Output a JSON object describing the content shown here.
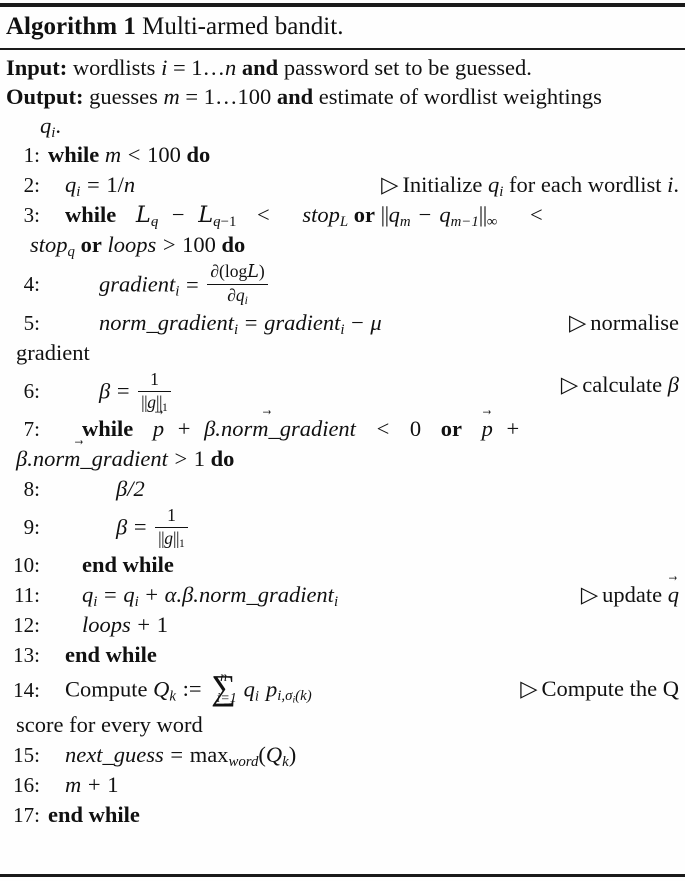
{
  "algorithm": {
    "caption_label": "Algorithm 1",
    "caption_title": "Multi-armed bandit.",
    "io": {
      "input_label": "Input:",
      "input_text_a": "wordlists",
      "input_math_i": "i",
      "input_eq": "= 1",
      "input_dots": "…",
      "input_n": "n",
      "input_and": "and",
      "input_text_b": "password set to be guessed.",
      "output_label": "Output:",
      "output_text_a": "guesses",
      "output_math_m": "m",
      "output_eq": "= 1",
      "output_dots": "…",
      "output_100": "100",
      "output_and": "and",
      "output_text_b": "estimate of wordlist weightings",
      "output_cont_q": "q",
      "output_cont_sub": "i",
      "output_cont_period": "."
    },
    "comment_marker": "▷",
    "lines": [
      {
        "number": "1:",
        "indent": 0,
        "kw_while": "while",
        "var_m": "m",
        "rel": "<",
        "val": "100",
        "kw_do": "do"
      },
      {
        "number": "2:",
        "indent": 1,
        "q": "q",
        "q_sub": "i",
        "eq": "=",
        "frac_inline": "1/",
        "n": "n",
        "comment_a": "Initialize",
        "comment_q": "q",
        "comment_q_sub": "i",
        "comment_b": "for each wordlist",
        "comment_i": "i",
        "comment_end": "."
      },
      {
        "number": "3:",
        "indent": 1,
        "kw_while": "while",
        "L1": "L",
        "L1_sub": "q",
        "minus": "−",
        "L2": "L",
        "L2_sub_q": "q",
        "L2_sub_rest": "−1",
        "rel1": "<",
        "stopL": "stop",
        "stopL_sub": "L",
        "or1": "or",
        "norm_open": "||",
        "qm": "q",
        "qm_sub": "m",
        "minus2": "−",
        "qm1": "q",
        "qm1_sub": "m−1",
        "norm_close": "||",
        "norm_sub": "∞",
        "rel2": "<",
        "cont_stopq": "stop",
        "cont_stopq_sub": "q",
        "or2": "or",
        "loops": "loops",
        "rel3": ">",
        "val": "100",
        "kw_do": "do"
      },
      {
        "number": "4:",
        "indent": 2,
        "lhs": "gradient",
        "lhs_sub": "i",
        "eq": "=",
        "frac_num_d": "∂(log",
        "frac_num_L": "L",
        "frac_num_close": ")",
        "frac_den_d": "∂q",
        "frac_den_sub": "i"
      },
      {
        "number": "5:",
        "indent": 2,
        "lhs": "norm_gradient",
        "lhs_sub": "i",
        "eq": "=",
        "rhs": "gradient",
        "rhs_sub": "i",
        "minus": "−",
        "mu": "μ",
        "comment": "normalise",
        "cont": "gradient"
      },
      {
        "number": "6:",
        "indent": 2,
        "beta": "β",
        "eq": "=",
        "frac_num": "1",
        "frac_den_open": "||",
        "frac_den_g": "g",
        "frac_den_close": "||",
        "frac_den_sub": "1",
        "comment": "calculate",
        "comment_beta": "β"
      },
      {
        "number": "7:",
        "indent": 2,
        "kw_while": "while",
        "p1": "p",
        "plus1": "+",
        "beta1": "β.",
        "ng1": "norm_gradient",
        "rel1": "<",
        "zero": "0",
        "or": "or",
        "p2": "p",
        "plus2": "+",
        "cont_beta": "β.",
        "cont_ng": "norm_gradient",
        "cont_rel": ">",
        "cont_one": "1",
        "kw_do": "do"
      },
      {
        "number": "8:",
        "indent": 3,
        "text": "β/2"
      },
      {
        "number": "9:",
        "indent": 3,
        "beta": "β",
        "eq": "=",
        "frac_num": "1",
        "frac_den_open": "||",
        "frac_den_g": "g",
        "frac_den_close": "||",
        "frac_den_sub": "1"
      },
      {
        "number": "10:",
        "indent": 2,
        "kw": "end while"
      },
      {
        "number": "11:",
        "indent": 2,
        "q": "q",
        "q_sub": "i",
        "eq": "=",
        "q2": "q",
        "q2_sub": "i",
        "plus": "+",
        "alpha": "α.",
        "beta": "β.",
        "ng": "norm_gradient",
        "ng_sub": "i",
        "comment": "update",
        "comment_q": "q"
      },
      {
        "number": "12:",
        "indent": 2,
        "loops": "loops",
        "plus": "+",
        "one": "1"
      },
      {
        "number": "13:",
        "indent": 1,
        "kw": "end while"
      },
      {
        "number": "14:",
        "indent": 1,
        "compute": "Compute",
        "Q": "Q",
        "Q_sub": "k",
        "assign": ":=",
        "sum_top": "n",
        "sum_bot": "i=1",
        "q": "q",
        "q_sub": "i",
        "p": "p",
        "p_sub": "i,σ",
        "p_sub_sub": "i",
        "p_sub_tail": "(k)",
        "comment": "Compute the Q",
        "cont": "score for every word"
      },
      {
        "number": "15:",
        "indent": 1,
        "lhs": "next_guess",
        "eq": "=",
        "max": "max",
        "max_sub": "word",
        "open": "(",
        "Q": "Q",
        "Q_sub": "k",
        "close": ")"
      },
      {
        "number": "16:",
        "indent": 1,
        "m": "m",
        "plus": "+",
        "one": "1"
      },
      {
        "number": "17:",
        "indent": 0,
        "kw": "end while"
      }
    ]
  }
}
